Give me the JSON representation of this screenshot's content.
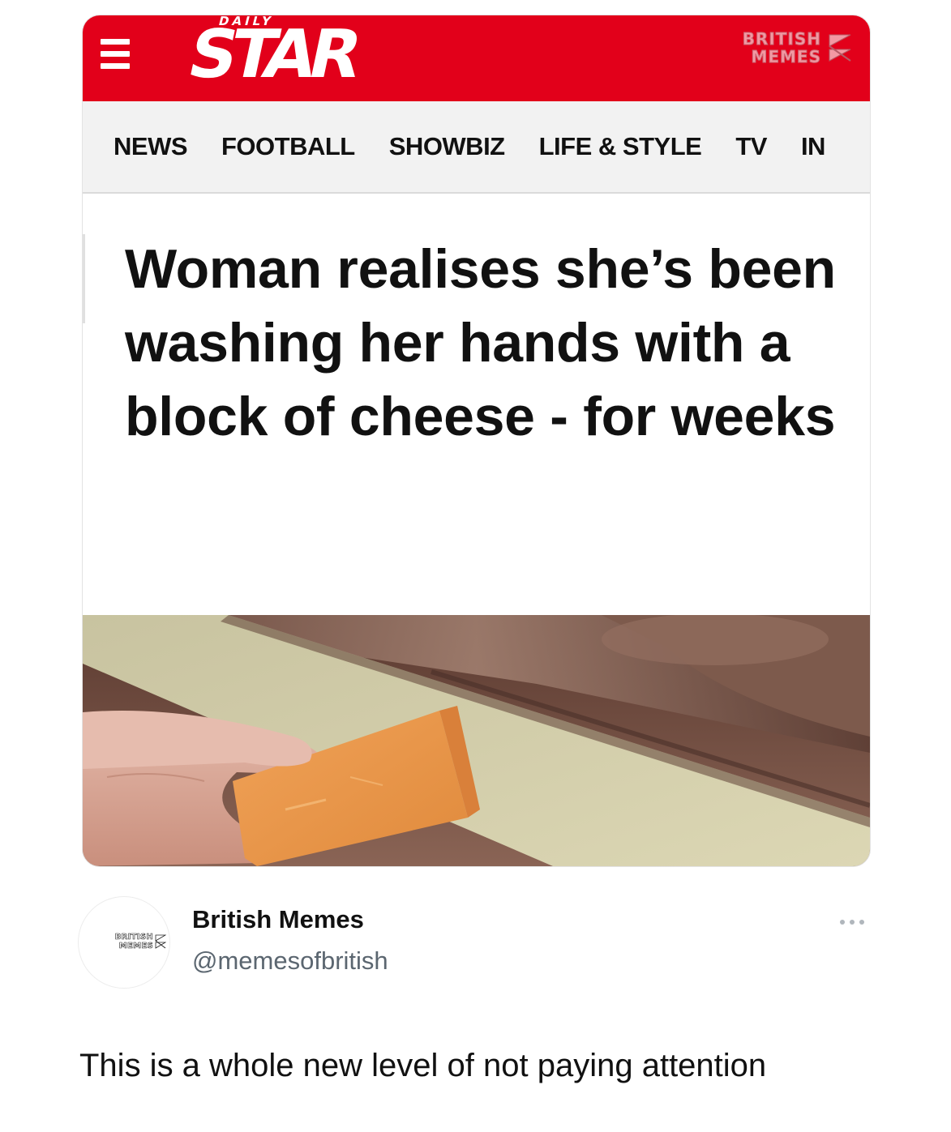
{
  "article": {
    "masthead": {
      "logo_small": "DAILY",
      "logo_main": "STAR",
      "brand_color": "#e2001a",
      "watermark": [
        "BRITISH",
        "MEMES"
      ]
    },
    "nav": {
      "items": [
        "NEWS",
        "FOOTBALL",
        "SHOWBIZ",
        "LIFE & STYLE",
        "TV",
        "IN"
      ]
    },
    "headline": "Woman realises she’s been washing her hands with a block of cheese - for weeks"
  },
  "post": {
    "avatar_text": [
      "BRITISH",
      "MEMES"
    ],
    "display_name": "British Memes",
    "handle": "@memesofbritish",
    "text": "This is a whole new level of not paying attention"
  },
  "icons": {
    "menu": "hamburger-icon",
    "more": "more-horizontal-icon",
    "flag": "union-jack-icon"
  }
}
